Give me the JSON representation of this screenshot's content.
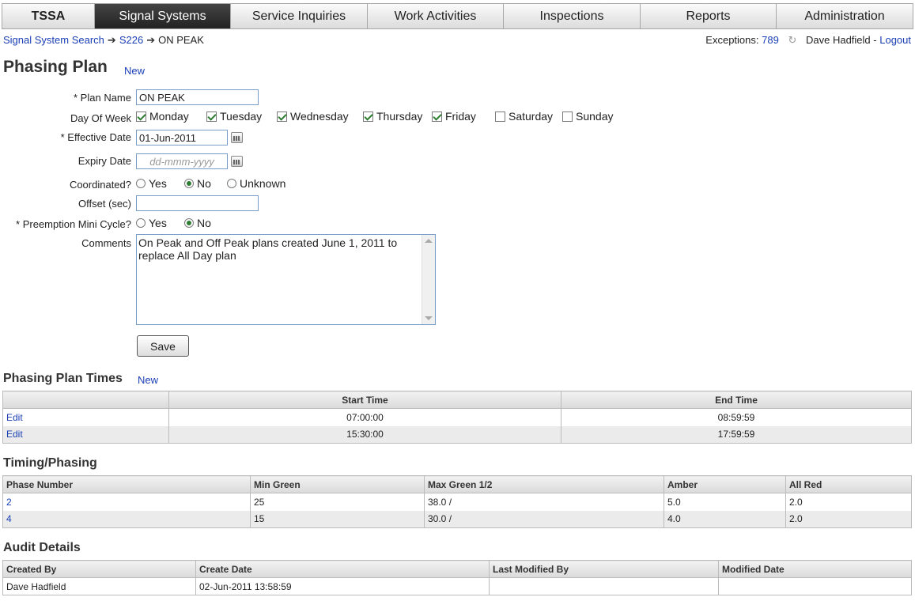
{
  "nav": {
    "brand": "TSSA",
    "tabs": [
      {
        "label": "Signal Systems",
        "active": true
      },
      {
        "label": "Service Inquiries"
      },
      {
        "label": "Work Activities"
      },
      {
        "label": "Inspections"
      },
      {
        "label": "Reports"
      },
      {
        "label": "Administration"
      }
    ]
  },
  "breadcrumb": {
    "items": [
      "Signal System Search",
      "S226",
      "ON PEAK"
    ],
    "separator": "➔"
  },
  "userbar": {
    "exceptions_label": "Exceptions:",
    "exceptions_count": "789",
    "user": "Dave Hadfield",
    "dash": "-",
    "logout": "Logout"
  },
  "page": {
    "title": "Phasing Plan",
    "new_link": "New"
  },
  "form": {
    "plan_name": {
      "label": "* Plan Name",
      "value": "ON PEAK"
    },
    "day_of_week": {
      "label": "Day Of Week",
      "days": [
        {
          "label": "Monday",
          "checked": true
        },
        {
          "label": "Tuesday",
          "checked": true
        },
        {
          "label": "Wednesday",
          "checked": true
        },
        {
          "label": "Thursday",
          "checked": true
        },
        {
          "label": "Friday",
          "checked": true
        },
        {
          "label": "Saturday",
          "checked": false
        },
        {
          "label": "Sunday",
          "checked": false
        }
      ]
    },
    "effective_date": {
      "label": "* Effective Date",
      "value": "01-Jun-2011"
    },
    "expiry_date": {
      "label": "Expiry Date",
      "value": "",
      "placeholder": "dd-mmm-yyyy"
    },
    "coordinated": {
      "label": "Coordinated?",
      "options": [
        {
          "label": "Yes",
          "selected": false
        },
        {
          "label": "No",
          "selected": true
        },
        {
          "label": "Unknown",
          "selected": false
        }
      ]
    },
    "offset": {
      "label": "Offset (sec)",
      "value": ""
    },
    "preemption": {
      "label": "* Preemption Mini Cycle?",
      "options": [
        {
          "label": "Yes",
          "selected": false
        },
        {
          "label": "No",
          "selected": true
        }
      ]
    },
    "comments": {
      "label": "Comments",
      "value": "On Peak and Off Peak plans created June 1, 2011 to replace All Day plan"
    },
    "save_label": "Save"
  },
  "plan_times": {
    "title": "Phasing Plan Times",
    "new_link": "New",
    "headers": [
      "",
      "Start Time",
      "End Time"
    ],
    "rows": [
      {
        "action": "Edit",
        "start": "07:00:00",
        "end": "08:59:59"
      },
      {
        "action": "Edit",
        "start": "15:30:00",
        "end": "17:59:59"
      }
    ]
  },
  "timing": {
    "title": "Timing/Phasing",
    "headers": [
      "Phase Number",
      "Min Green",
      "Max Green 1/2",
      "Amber",
      "All Red"
    ],
    "rows": [
      {
        "phase": "2",
        "min": "25",
        "max": "38.0 /",
        "amber": "5.0",
        "red": "2.0"
      },
      {
        "phase": "4",
        "min": "15",
        "max": "30.0 /",
        "amber": "4.0",
        "red": "2.0"
      }
    ]
  },
  "audit": {
    "title": "Audit Details",
    "headers": [
      "Created By",
      "Create Date",
      "Last Modified By",
      "Modified Date"
    ],
    "rows": [
      {
        "created_by": "Dave Hadfield",
        "create_date": "02-Jun-2011 13:58:59",
        "modified_by": "",
        "modified_date": ""
      }
    ]
  }
}
